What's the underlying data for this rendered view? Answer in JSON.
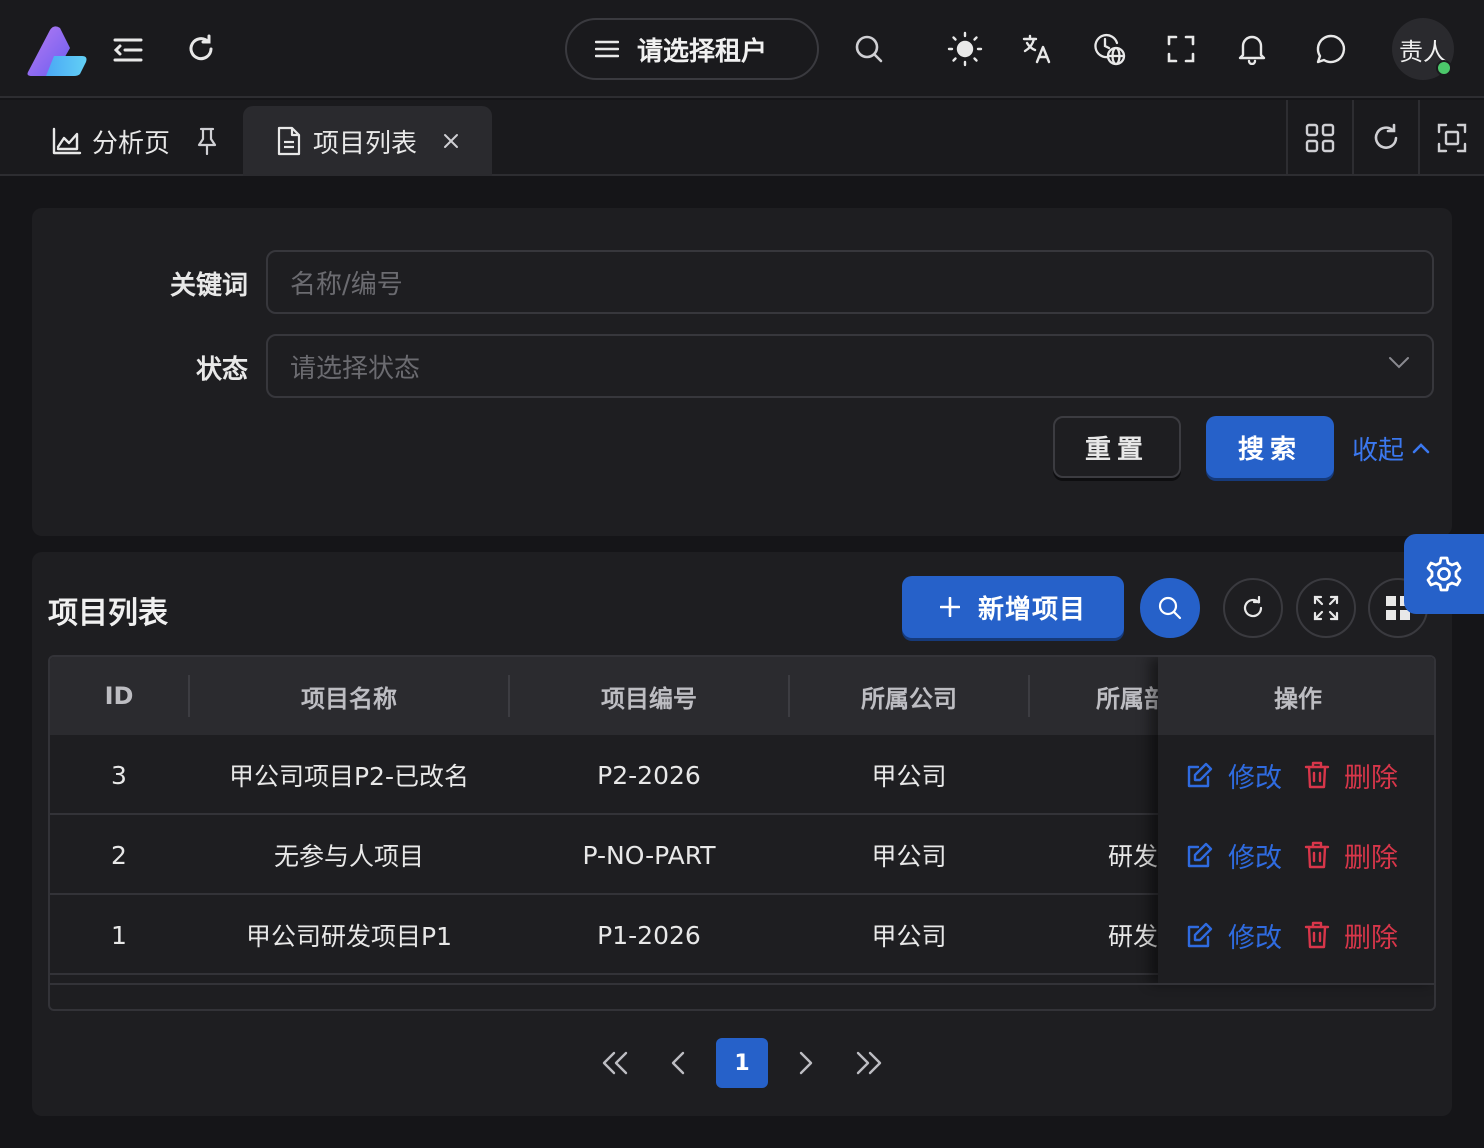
{
  "header": {
    "tenant_label": "请选择租户",
    "avatar_text": "责人"
  },
  "tabs": [
    {
      "label": "分析页"
    },
    {
      "label": "项目列表"
    }
  ],
  "filter": {
    "keyword_label": "关键词",
    "keyword_placeholder": "名称/编号",
    "status_label": "状态",
    "status_placeholder": "请选择状态",
    "reset_label": "重置",
    "search_label": "搜索",
    "collapse_label": "收起"
  },
  "list": {
    "title": "项目列表",
    "add_label": "新增项目",
    "columns": [
      "ID",
      "项目名称",
      "项目编号",
      "所属公司",
      "所属部",
      "操作"
    ],
    "rows": [
      {
        "id": "3",
        "name": "甲公司项目P2-已改名",
        "code": "P2-2026",
        "company": "甲公司",
        "dept": ""
      },
      {
        "id": "2",
        "name": "无参与人项目",
        "code": "P-NO-PART",
        "company": "甲公司",
        "dept": "研发"
      },
      {
        "id": "1",
        "name": "甲公司研发项目P1",
        "code": "P1-2026",
        "company": "甲公司",
        "dept": "研发"
      }
    ],
    "edit_label": "修改",
    "delete_label": "删除"
  },
  "pagination": {
    "current": "1"
  },
  "colors": {
    "primary": "#2661c9",
    "danger": "#d8364a",
    "edit": "#2f6be0"
  }
}
